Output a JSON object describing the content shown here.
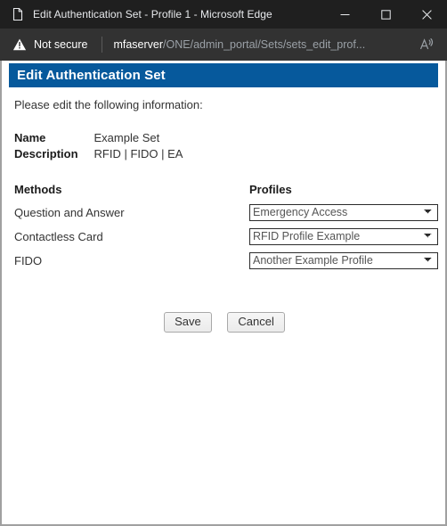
{
  "window": {
    "tab_title": "Edit Authentication Set - Profile 1 - Microsoft Edge",
    "favicon": "page-icon",
    "minimize_label": "Minimize",
    "maximize_label": "Maximize",
    "close_label": "Close"
  },
  "addressbar": {
    "security_icon": "warning-triangle-icon",
    "security_text": "Not secure",
    "url_host": "mfaserver",
    "url_path": "/ONE/admin_portal/Sets/sets_edit_prof...",
    "read_aloud_icon": "read-aloud-icon"
  },
  "page": {
    "banner_title": "Edit Authentication Set",
    "banner_color": "#06599C",
    "intro": "Please edit the following information:",
    "info": [
      {
        "label": "Name",
        "value": "Example Set"
      },
      {
        "label": "Description",
        "value": "RFID | FIDO | EA"
      }
    ],
    "methods_header": "Methods",
    "profiles_header": "Profiles",
    "rows": [
      {
        "method": "Question and Answer",
        "profile": "Emergency Access"
      },
      {
        "method": "Contactless Card",
        "profile": "RFID Profile Example"
      },
      {
        "method": "FIDO",
        "profile": "Another Example Profile"
      }
    ],
    "save_label": "Save",
    "cancel_label": "Cancel"
  }
}
